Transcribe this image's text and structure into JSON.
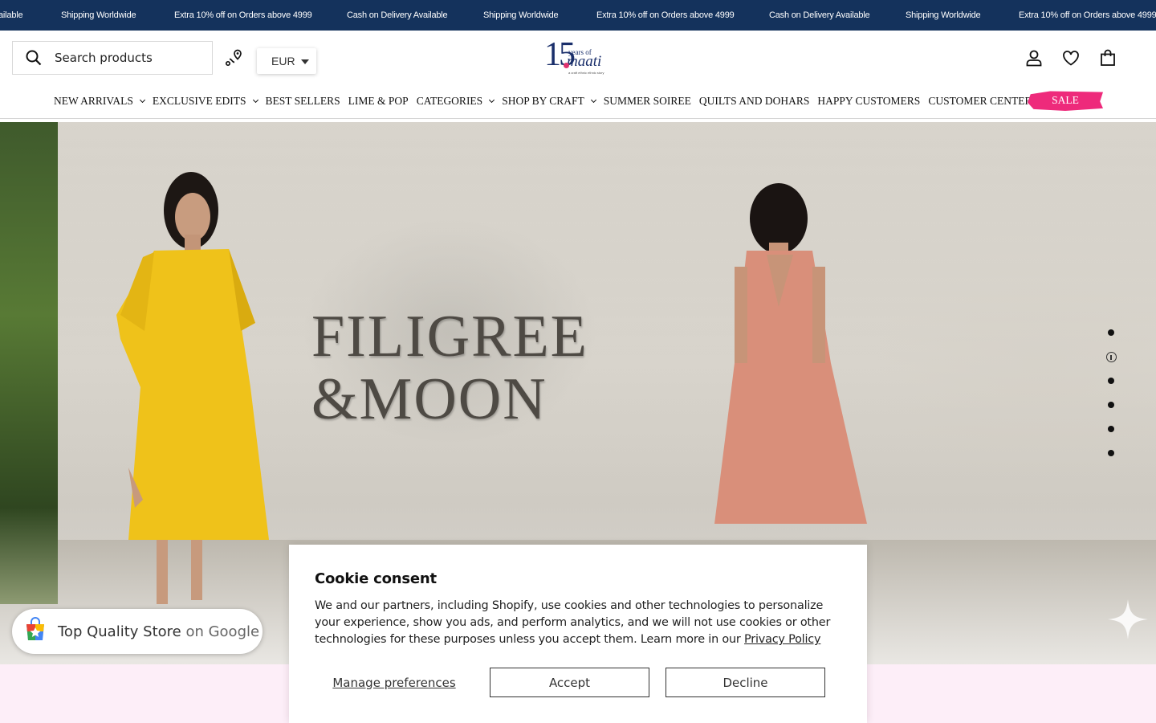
{
  "announcements": [
    "ailable",
    "Shipping Worldwide",
    "Extra 10% off on Orders above 4999",
    "Cash on Delivery Available",
    "Shipping Worldwide",
    "Extra 10% off on Orders above 4999",
    "Cash on Delivery Available",
    "Shipping Worldwide",
    "Extra 10% off on Orders above 4999"
  ],
  "header": {
    "search_placeholder": "Search products",
    "currency": "EUR",
    "logo": {
      "number": "15",
      "years": "years of",
      "brand": "maati",
      "tagline": "a craft ethnic ethnic story"
    },
    "icons": [
      "search-icon",
      "store-locator-icon",
      "account-icon",
      "wishlist-icon",
      "bag-icon"
    ]
  },
  "nav": {
    "items": [
      {
        "label": "NEW ARRIVALS",
        "has_dropdown": true
      },
      {
        "label": "EXCLUSIVE EDITS",
        "has_dropdown": true
      },
      {
        "label": "BEST SELLERS",
        "has_dropdown": false
      },
      {
        "label": "LIME & POP",
        "has_dropdown": false
      },
      {
        "label": "CATEGORIES",
        "has_dropdown": true
      },
      {
        "label": "SHOP BY CRAFT",
        "has_dropdown": true
      },
      {
        "label": "SUMMER SOIREE",
        "has_dropdown": false
      },
      {
        "label": "QUILTS AND DOHARS",
        "has_dropdown": false
      },
      {
        "label": "HAPPY CUSTOMERS",
        "has_dropdown": false
      },
      {
        "label": "CUSTOMER CENTER",
        "has_dropdown": true
      }
    ],
    "sale_label": "SALE",
    "sale_color": "#ee2a7b"
  },
  "hero": {
    "title_line1": "FILIGREE",
    "title_line2": "&MOON",
    "slide_count": 6,
    "active_slide": 2
  },
  "google_badge": {
    "text": "Top Quality Store",
    "suffix": "on Google"
  },
  "cookie": {
    "title": "Cookie consent",
    "body": "We and our partners, including Shopify, use cookies and other technologies to personalize your experience, show you ads, and perform analytics, and we will not use cookies or other technologies for these purposes unless you accept them. Learn more in our",
    "policy_link": "Privacy Policy",
    "manage_label": "Manage preferences",
    "accept_label": "Accept",
    "decline_label": "Decline"
  },
  "colors": {
    "announce_bg": "#14325c",
    "band_bg": "#fdeef8",
    "brand_navy": "#1a2f6b"
  }
}
